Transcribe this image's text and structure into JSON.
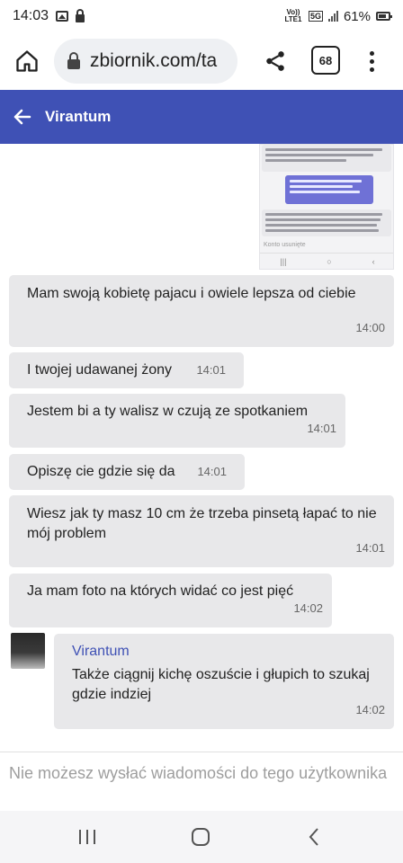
{
  "status_bar": {
    "time": "14:03",
    "network_label": "5G",
    "volte_label": "Vo)) LTE1",
    "battery": "61%",
    "icons": [
      "image-icon",
      "lock-icon",
      "signal-icon",
      "battery-icon"
    ]
  },
  "browser": {
    "url": "zbiornik.com/ta",
    "tab_count": "68",
    "icons": [
      "home-icon",
      "lock-icon",
      "share-icon",
      "tabs-icon",
      "more-icon"
    ]
  },
  "header": {
    "title": "Virantum",
    "accent_color": "#3f51b5"
  },
  "messages": [
    {
      "text": "Mam swoją kobietę pajacu i owiele lepsza od ciebie",
      "time": "14:00"
    },
    {
      "text": "I twojej udawanej żony",
      "time": "14:01"
    },
    {
      "text": "Jestem bi a ty walisz w czują ze spotkaniem",
      "time": "14:01"
    },
    {
      "text": "Opiszę cie gdzie się da",
      "time": "14:01"
    },
    {
      "text": "Wiesz jak ty masz 10 cm że trzeba pinsetą łapać to nie mój problem",
      "time": "14:01"
    },
    {
      "text": "Ja mam foto na których widać co jest pięć",
      "time": "14:02"
    }
  ],
  "incoming": {
    "sender": "Virantum",
    "text": "Także ciągnij kichę oszuście i głupich to szukaj gdzie indziej",
    "time": "14:02"
  },
  "notice": {
    "text": "Nie możesz wysłać wiadomości do tego użytkownika"
  },
  "nav": {
    "icons": [
      "recents-icon",
      "home-circle-icon",
      "back-chevron-icon"
    ]
  }
}
